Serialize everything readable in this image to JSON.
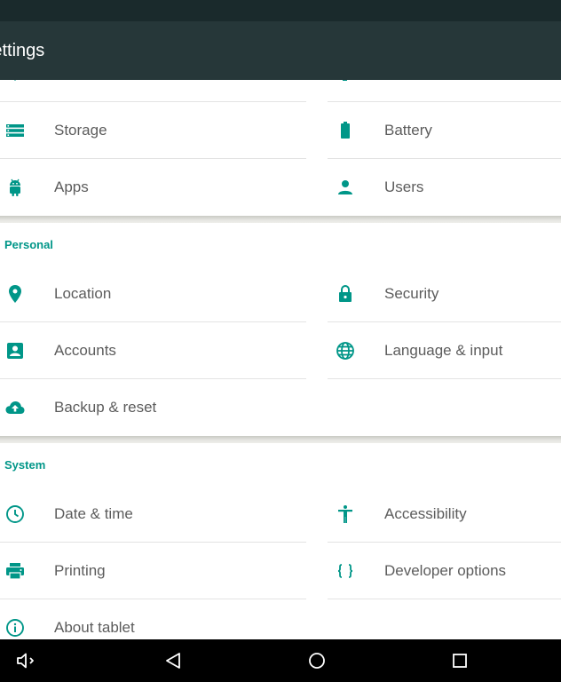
{
  "app_title": "Settings",
  "accent_color": "#009688",
  "device_section": {
    "partial_top": [
      "display",
      "sound-notifications"
    ],
    "items": [
      {
        "label": "Storage",
        "icon": "storage-icon"
      },
      {
        "label": "Battery",
        "icon": "battery-icon"
      },
      {
        "label": "Apps",
        "icon": "android-icon"
      },
      {
        "label": "Users",
        "icon": "person-icon"
      }
    ]
  },
  "personal_section": {
    "title": "Personal",
    "items": [
      {
        "label": "Location",
        "icon": "location-pin-icon"
      },
      {
        "label": "Security",
        "icon": "lock-icon"
      },
      {
        "label": "Accounts",
        "icon": "account-box-icon"
      },
      {
        "label": "Language & input",
        "icon": "globe-icon"
      },
      {
        "label": "Backup & reset",
        "icon": "cloud-upload-icon"
      }
    ]
  },
  "system_section": {
    "title": "System",
    "items": [
      {
        "label": "Date & time",
        "icon": "clock-icon"
      },
      {
        "label": "Accessibility",
        "icon": "accessibility-icon"
      },
      {
        "label": "Printing",
        "icon": "printer-icon"
      },
      {
        "label": "Developer options",
        "icon": "code-braces-icon"
      },
      {
        "label": "About tablet",
        "icon": "info-icon"
      }
    ]
  },
  "navigation_bar": [
    "volume-icon",
    "back-icon",
    "home-icon",
    "recents-icon"
  ]
}
